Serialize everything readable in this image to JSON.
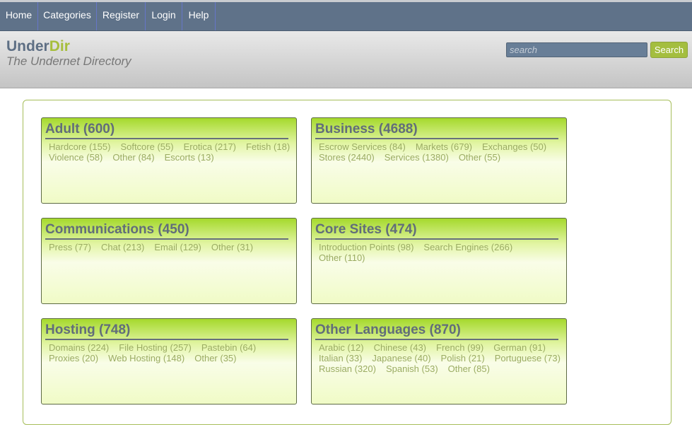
{
  "nav": {
    "items": [
      {
        "label": "Home"
      },
      {
        "label": "Categories"
      },
      {
        "label": "Register"
      },
      {
        "label": "Login"
      },
      {
        "label": "Help"
      }
    ]
  },
  "header": {
    "logo_under": "Under",
    "logo_dir": "Dir",
    "tagline": "The Undernet Directory",
    "search_placeholder": "search",
    "search_button": "Search"
  },
  "colors": {
    "nav_bg": "#5f7289",
    "brand_gray": "#5e6f84",
    "brand_green": "#a6be3c",
    "link_green": "#9bac63"
  },
  "categories": [
    {
      "title": "Adult (600)",
      "rows": [
        [
          "Hardcore (155)",
          "Softcore (55)",
          "Erotica (217)",
          "Fetish (18)"
        ],
        [
          "Violence (58)",
          "Other (84)",
          "Escorts (13)"
        ]
      ]
    },
    {
      "title": "Business (4688)",
      "rows": [
        [
          "Escrow Services (84)",
          "Markets (679)",
          "Exchanges (50)"
        ],
        [
          "Stores (2440)",
          "Services (1380)",
          "Other (55)"
        ]
      ]
    },
    {
      "title": "Communications (450)",
      "rows": [
        [
          "Press (77)",
          "Chat (213)",
          "Email (129)",
          "Other (31)"
        ]
      ]
    },
    {
      "title": "Core Sites (474)",
      "rows": [
        [
          "Introduction Points (98)",
          "Search Engines (266)"
        ],
        [
          "Other (110)"
        ]
      ]
    },
    {
      "title": "Hosting (748)",
      "rows": [
        [
          "Domains (224)",
          "File Hosting (257)",
          "Pastebin (64)"
        ],
        [
          "Proxies (20)",
          "Web Hosting (148)",
          "Other (35)"
        ]
      ]
    },
    {
      "title": "Other Languages (870)",
      "rows": [
        [
          "Arabic (12)",
          "Chinese (43)",
          "French (99)",
          "German (91)"
        ],
        [
          "Italian (33)",
          "Japanese (40)",
          "Polish (21)",
          "Portuguese (73)"
        ],
        [
          "Russian (320)",
          "Spanish (53)",
          "Other (85)"
        ]
      ]
    }
  ]
}
